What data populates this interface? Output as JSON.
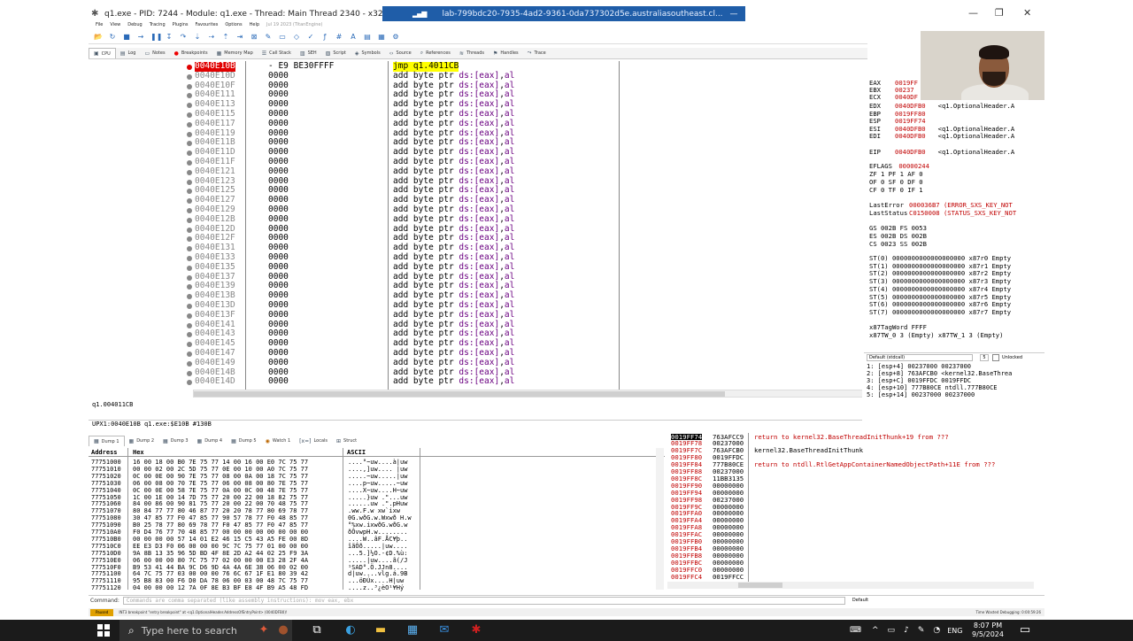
{
  "window": {
    "title": "q1.exe - PID: 7244 - Module: q1.exe - Thread: Main Thread 2340 - x32dbg",
    "remote_title": "lab-799bdc20-7935-4ad2-9361-0da737302d5e.australiasoutheast.cl...",
    "controls": [
      "—",
      "❐",
      "✕"
    ]
  },
  "menu": [
    "File",
    "View",
    "Debug",
    "Tracing",
    "Plugins",
    "Favourites",
    "Options",
    "Help",
    "Jul 19 2023 (TitanEngine)"
  ],
  "tabs_top": [
    "CPU",
    "Log",
    "Notes",
    "Breakpoints",
    "Memory Map",
    "Call Stack",
    "SEH",
    "Script",
    "Symbols",
    "Source",
    "References",
    "Threads",
    "Handles",
    "Trace"
  ],
  "disasm": {
    "current": {
      "addr": "0040E10B",
      "bytes": "- E9 BE30FFFF",
      "mnemonic": "jmp",
      "operand": "q1.4011CB"
    },
    "rows": [
      {
        "addr": "0040E10D"
      },
      {
        "addr": "0040E10F"
      },
      {
        "addr": "0040E111"
      },
      {
        "addr": "0040E113"
      },
      {
        "addr": "0040E115"
      },
      {
        "addr": "0040E117"
      },
      {
        "addr": "0040E119"
      },
      {
        "addr": "0040E11B"
      },
      {
        "addr": "0040E11D"
      },
      {
        "addr": "0040E11F"
      },
      {
        "addr": "0040E121"
      },
      {
        "addr": "0040E123"
      },
      {
        "addr": "0040E125"
      },
      {
        "addr": "0040E127"
      },
      {
        "addr": "0040E129"
      },
      {
        "addr": "0040E12B"
      },
      {
        "addr": "0040E12D"
      },
      {
        "addr": "0040E12F"
      },
      {
        "addr": "0040E131"
      },
      {
        "addr": "0040E133"
      },
      {
        "addr": "0040E135"
      },
      {
        "addr": "0040E137"
      },
      {
        "addr": "0040E139"
      },
      {
        "addr": "0040E13B"
      },
      {
        "addr": "0040E13D"
      },
      {
        "addr": "0040E13F"
      },
      {
        "addr": "0040E141"
      },
      {
        "addr": "0040E143"
      },
      {
        "addr": "0040E145"
      },
      {
        "addr": "0040E147"
      },
      {
        "addr": "0040E149"
      },
      {
        "addr": "0040E14B"
      },
      {
        "addr": "0040E14D"
      }
    ],
    "row_bytes": "0000",
    "row_ins": {
      "op": "add",
      "size": "byte ptr",
      "seg": "ds:",
      "mem": "[eax]",
      "comma": ",",
      "reg": "al"
    }
  },
  "registers": [
    {
      "n": "EAX",
      "v": "0019FF",
      "c": ""
    },
    {
      "n": "EBX",
      "v": "00237",
      "c": ""
    },
    {
      "n": "ECX",
      "v": "0040DF",
      "c": ""
    },
    {
      "n": "EDX",
      "v": "0040DFB0",
      "c": "<q1.OptionalHeader.A"
    },
    {
      "n": "EBP",
      "v": "0019FF80",
      "c": ""
    },
    {
      "n": "ESP",
      "v": "0019FF74",
      "c": ""
    },
    {
      "n": "ESI",
      "v": "0040DFB0",
      "c": "<q1.OptionalHeader.A"
    },
    {
      "n": "EDI",
      "v": "0040DFB0",
      "c": "<q1.OptionalHeader.A"
    },
    {
      "n": "EIP",
      "v": "0040DFB0",
      "c": "<q1.OptionalHeader.A"
    }
  ],
  "flags": {
    "eflags_label": "EFLAGS",
    "eflags": "00000244",
    "line1": "ZF 1  PF 1  AF 0",
    "line2": "OF 0  SF 0  DF 0",
    "line3": "CF 0  TF 0  IF 1"
  },
  "errors": {
    "last_error_label": "LastError",
    "last_error": "000036B7 (ERROR_SXS_KEY_NOT",
    "last_status_label": "LastStatus",
    "last_status": "C0150008 (STATUS_SXS_KEY_NOT"
  },
  "segments": [
    "GS 002B  FS 0053",
    "ES 002B  DS 002B",
    "CS 0023  SS 002B"
  ],
  "fpu": [
    "ST(0) 0000000000000000000 x87r0 Empty",
    "ST(1) 0000000000000000000 x87r1 Empty",
    "ST(2) 0000000000000000000 x87r2 Empty",
    "ST(3) 0000000000000000000 x87r3 Empty",
    "ST(4) 0000000000000000000 x87r4 Empty",
    "ST(5) 0000000000000000000 x87r5 Empty",
    "ST(6) 0000000000000000000 x87r6 Empty",
    "ST(7) 0000000000000000000 x87r7 Empty"
  ],
  "tagword": "x87TagWord  FFFF",
  "tagword2": "x87TW_0 3 (Empty)    x87TW_1 3 (Empty)",
  "callconv": {
    "selected": "Default (stdcall)",
    "count": "5",
    "unlocked": "Unlocked"
  },
  "stack_args": [
    "1: [esp+4]  00237000 00237000",
    "2: [esp+8]  763AFCB0 <kernel32.BaseThrea",
    "3: [esp+C]  0019FFDC 0019FFDC",
    "4: [esp+10] 777B80CE ntdll.777B80CE",
    "5: [esp+14] 00237000 00237000"
  ],
  "info": {
    "line1": "q1.004011CB",
    "addrline": "UPX1:0040E10B q1.exe:$E10B #130B"
  },
  "tabs_dump": [
    "Dump 1",
    "Dump 2",
    "Dump 3",
    "Dump 4",
    "Dump 5",
    "Watch 1",
    "Locals",
    "Struct"
  ],
  "dump": {
    "headers": {
      "address": "Address",
      "hex": "Hex",
      "ascii": "ASCII"
    },
    "rows": [
      {
        "a": "77751000",
        "h": "16 00 18 00 B0 7E 75 77 14 00 16 00 E0 7C 75 77",
        "t": "....°~uw....à|uw"
      },
      {
        "a": "77751010",
        "h": "00 00 02 00 2C 5D 75 77 0E 00 10 00 A0 7C 75 77",
        "t": "....,]uw.... |uw"
      },
      {
        "a": "77751020",
        "h": "0C 00 0E 00 90 7E 75 77 08 00 0A 00 18 7C 75 77",
        "t": ".....~uw.....|uw"
      },
      {
        "a": "77751030",
        "h": "06 00 08 00 70 7E 75 77 06 00 08 00 80 7E 75 77",
        "t": "....p~uw.....~uw"
      },
      {
        "a": "77751040",
        "h": "0C 00 0E 00 58 7E 75 77 0A 00 0C 00 48 7E 75 77",
        "t": "....X~uw....H~uw"
      },
      {
        "a": "77751050",
        "h": "1C 00 1E 00 14 7D 75 77 20 00 22 00 18 82 75 77",
        "t": ".....}uw .\"...uw"
      },
      {
        "a": "77751060",
        "h": "84 00 86 00 90 81 75 77 20 00 22 00 70 48 75 77",
        "t": "......uw .\".pHuw"
      },
      {
        "a": "77751070",
        "h": "80 84 77 77 80 46 87 77 20 20 78 77 80 69 78 77",
        "t": ".ww.F.w  xw`ixw"
      },
      {
        "a": "77751080",
        "h": "30 47 85 77 F0 47 85 77 90 57 78 77 F0 48 85 77",
        "t": "0G.wðG.w.Wxwð H.w"
      },
      {
        "a": "77751090",
        "h": "B0 25 78 77 80 69 78 77 F0 47 85 77 F0 47 85 77",
        "t": "°%xw.ixwðG.wðG.w"
      },
      {
        "a": "777510A0",
        "h": "F0 D4 76 77 70 48 85 77 00 00 00 00 00 00 00 00",
        "t": "ðÔvwpH.w........"
      },
      {
        "a": "777510B0",
        "h": "00 00 00 00 57 14 01 E2 46 15 C5 43 A5 FE 00 8D",
        "t": "....W..âF.ÅC¥þ.."
      },
      {
        "a": "777510C0",
        "h": "EE E3 D3 F0 06 00 00 00 9C 7C 75 77 01 00 00 00",
        "t": "îãÓð.....|uw...."
      },
      {
        "a": "777510D0",
        "h": "9A 8B 13 35 96 5D BD 4F 8E 2D A2 44 02 25 F9 3A",
        "t": "...5.]½O.-¢D.%ù:"
      },
      {
        "a": "777510E0",
        "h": "06 00 00 00 80 7C 75 77 02 00 00 00 E3 28 2F 4A",
        "t": ".....|uw....ã(/J"
      },
      {
        "a": "777510F0",
        "h": "B9 53 41 44 BA 9C D6 9D 4A 4A 6E 38 06 00 02 00",
        "t": "¹SAD°.Ö.JJn8...."
      },
      {
        "a": "77751100",
        "h": "64 7C 75 77 03 00 00 00 76 6C 67 1F E1 80 39 42",
        "t": "d|uw....vlg.á.9B"
      },
      {
        "a": "77751110",
        "h": "95 B8 83 00 F6 D0 DA 78 06 00 03 00 48 7C 75 77",
        "t": "...öÐÚx....H|uw"
      },
      {
        "a": "77751120",
        "h": "04 00 00 00 12 7A 0F 8E B3 BF E8 4F B9 A5 48 FD",
        "t": "....z..³¿èO¹¥Hý"
      }
    ]
  },
  "stack": [
    {
      "a": "0019FF74",
      "v": "763AFCC9",
      "c": "return to kernel32.BaseThreadInitThunk+19 from ???"
    },
    {
      "a": "0019FF78",
      "v": "00237000",
      "c": ""
    },
    {
      "a": "0019FF7C",
      "v": "763AFCB0",
      "c": "kernel32.BaseThreadInitThunk"
    },
    {
      "a": "0019FF80",
      "v": "0019FFDC",
      "c": ""
    },
    {
      "a": "0019FF84",
      "v": "777B80CE",
      "c": "return to ntdll.RtlGetAppContainerNamedObjectPath+11E from ???"
    },
    {
      "a": "0019FF88",
      "v": "00237000",
      "c": ""
    },
    {
      "a": "0019FF8C",
      "v": "11BB3135",
      "c": ""
    },
    {
      "a": "0019FF90",
      "v": "00000000",
      "c": ""
    },
    {
      "a": "0019FF94",
      "v": "00000000",
      "c": ""
    },
    {
      "a": "0019FF98",
      "v": "00237000",
      "c": ""
    },
    {
      "a": "0019FF9C",
      "v": "00000000",
      "c": ""
    },
    {
      "a": "0019FFA0",
      "v": "00000000",
      "c": ""
    },
    {
      "a": "0019FFA4",
      "v": "00000000",
      "c": ""
    },
    {
      "a": "0019FFA8",
      "v": "00000000",
      "c": ""
    },
    {
      "a": "0019FFAC",
      "v": "00000000",
      "c": ""
    },
    {
      "a": "0019FFB0",
      "v": "00000000",
      "c": ""
    },
    {
      "a": "0019FFB4",
      "v": "00000000",
      "c": ""
    },
    {
      "a": "0019FFB8",
      "v": "00000000",
      "c": ""
    },
    {
      "a": "0019FFBC",
      "v": "00000000",
      "c": ""
    },
    {
      "a": "0019FFC0",
      "v": "00000000",
      "c": ""
    },
    {
      "a": "0019FFC4",
      "v": "0019FFCC",
      "c": ""
    }
  ],
  "command": {
    "label": "Command:",
    "placeholder": "Commands are comma separated (like assembly instructions): mov eax, ebx",
    "default": "Default"
  },
  "status": {
    "state": "Paused",
    "message": "INT3 breakpoint \"entry breakpoint\" at <q1.OptionalHeader.AddressOfEntryPoint> (0040DFB0)!",
    "time": "Time Wasted Debugging: 0:00:59:26"
  },
  "taskbar": {
    "search": "Type here to search",
    "time": "8:07 PM",
    "date": "9/5/2024",
    "lang": "ENG"
  },
  "colors": {
    "accent": "#1f5da8",
    "breakpoint": "#e00000",
    "highlight": "#ffff00",
    "register_value": "#c00000"
  }
}
